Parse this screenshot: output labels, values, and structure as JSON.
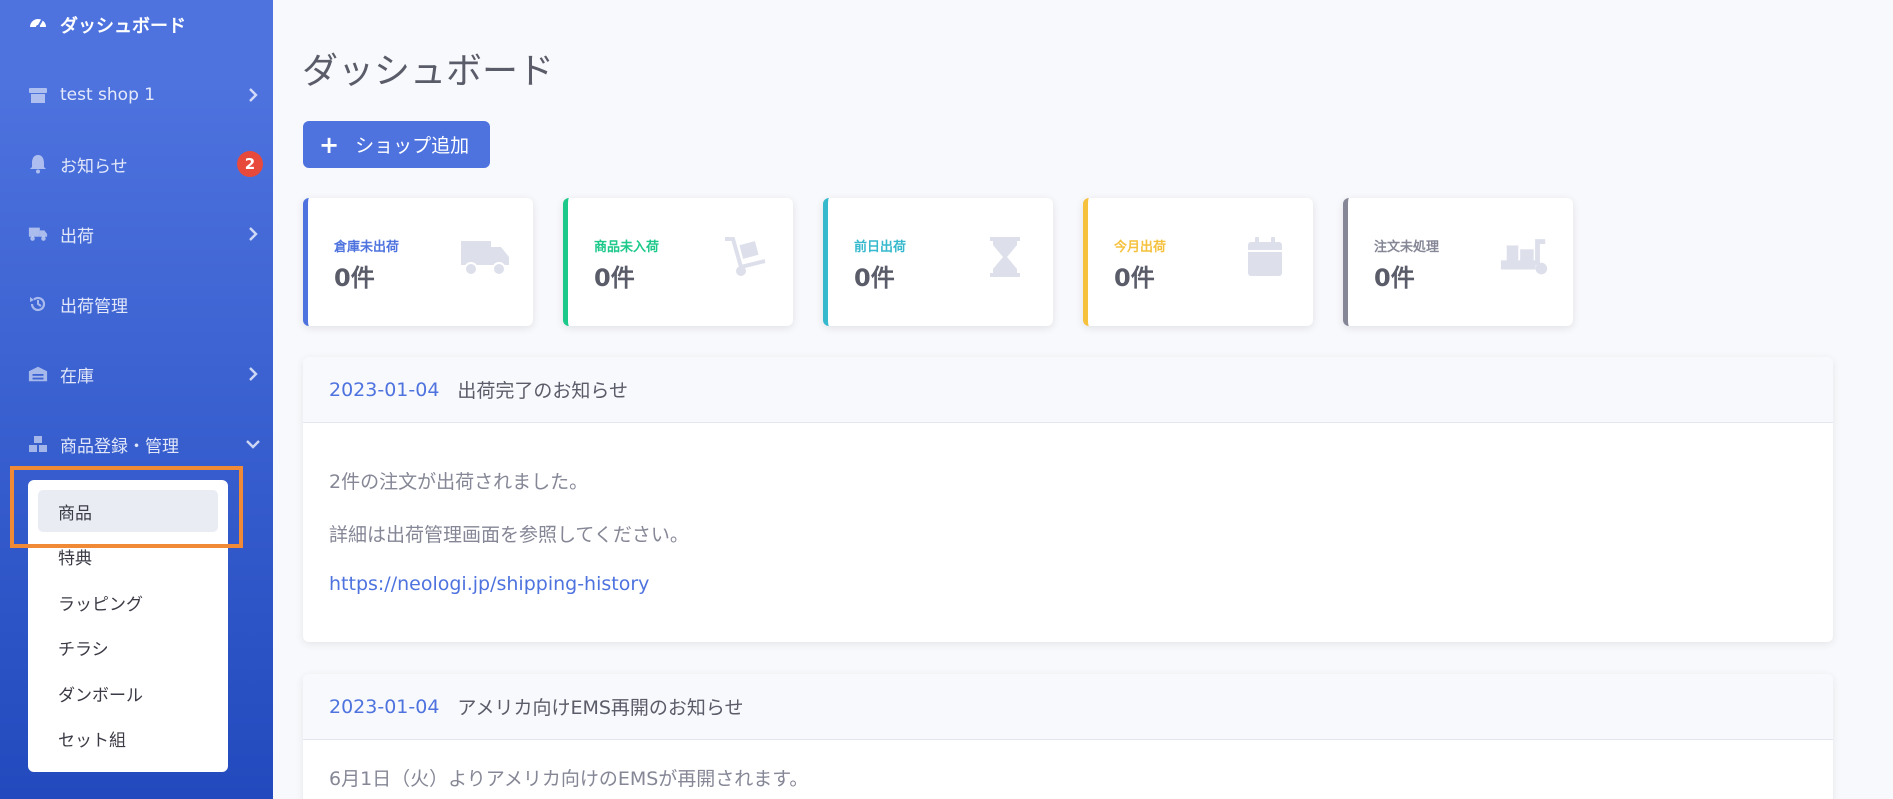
{
  "sidebar": {
    "brand": {
      "label": "ダッシュボード",
      "icon": "dashboard-gauge-icon"
    },
    "items": [
      {
        "label": "test shop 1",
        "icon": "store-icon",
        "chevron": "right"
      },
      {
        "label": "お知らせ",
        "icon": "bell-icon",
        "badge": "2"
      },
      {
        "label": "出荷",
        "icon": "truck-icon",
        "chevron": "right"
      },
      {
        "label": "出荷管理",
        "icon": "history-icon"
      },
      {
        "label": "在庫",
        "icon": "warehouse-icon",
        "chevron": "right"
      },
      {
        "label": "商品登録・管理",
        "icon": "boxes-icon",
        "chevron": "down"
      }
    ],
    "submenu": [
      "商品",
      "特典",
      "ラッピング",
      "チラシ",
      "ダンボール",
      "セット組"
    ],
    "active_submenu": "商品"
  },
  "main": {
    "title": "ダッシュボード",
    "add_shop_label": "ショップ追加",
    "cards": [
      {
        "label": "倉庫未出荷",
        "value": "0件",
        "color": "#4e73df",
        "icon": "truck-icon"
      },
      {
        "label": "商品未入荷",
        "value": "0件",
        "color": "#1cc88a",
        "icon": "dolly-icon"
      },
      {
        "label": "前日出荷",
        "value": "0件",
        "color": "#36b9cc",
        "icon": "hourglass-icon"
      },
      {
        "label": "今月出荷",
        "value": "0件",
        "color": "#f6c23e",
        "icon": "calendar-icon"
      },
      {
        "label": "注文未処理",
        "value": "0件",
        "color": "#858796",
        "icon": "dolly-flatbed-icon"
      }
    ],
    "notices": [
      {
        "date": "2023-01-04",
        "title": "出荷完了のお知らせ",
        "lines": [
          "2件の注文が出荷されました。",
          "詳細は出荷管理画面を参照してください。"
        ],
        "link": "https://neologi.jp/shipping-history"
      },
      {
        "date": "2023-01-04",
        "title": "アメリカ向けEMS再開のお知らせ",
        "lines": [
          "6月1日（火）よりアメリカ向けのEMSが再開されます。"
        ]
      }
    ]
  },
  "colors": {
    "primary": "#4e73df",
    "danger": "#e74a3b",
    "highlight": "#f08a36"
  }
}
